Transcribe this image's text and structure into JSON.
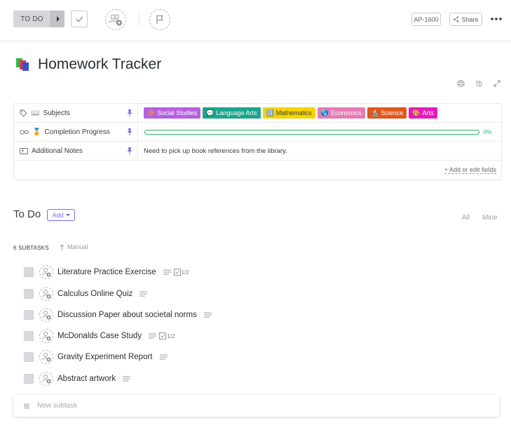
{
  "topbar": {
    "status_label": "TO DO",
    "task_id": "AP-1600",
    "share_label": "Share"
  },
  "title": {
    "text": "Homework Tracker"
  },
  "fields": {
    "subjects_label": "Subjects",
    "subjects_emoji": "📖",
    "progress_label": "Completion Progress",
    "progress_emoji": "🏅",
    "progress_percent": 0,
    "progress_text": "0%",
    "notes_label": "Additional Notes",
    "notes_value": "Need to pick up book references from the library.",
    "edit_fields_label": "+ Add or edit fields",
    "tags": [
      {
        "label": "Social Studies",
        "emoji": "🔆",
        "color": "#b660e0"
      },
      {
        "label": "Language Arts",
        "emoji": "💬",
        "color": "#1aa58c"
      },
      {
        "label": "Mathematics",
        "emoji": "🔢",
        "color": "#f5d400"
      },
      {
        "label": "Economics",
        "emoji": "🌎",
        "color": "#e57ab4"
      },
      {
        "label": "Science",
        "emoji": "🔬",
        "color": "#e2561c"
      },
      {
        "label": "Arts",
        "emoji": "🎨",
        "color": "#e51bba"
      }
    ]
  },
  "todo": {
    "title": "To Do",
    "add_label": "Add",
    "filter_all": "All",
    "filter_mine": "Mine",
    "subtasks_count": "6 SUBTASKS",
    "sort_label": "Manual",
    "new_subtask_placeholder": "New subtask",
    "subtasks": [
      {
        "name": "Literature Practice Exercise",
        "checklist": "1/2"
      },
      {
        "name": "Calculus Online Quiz",
        "checklist": ""
      },
      {
        "name": "Discussion Paper about societal norms",
        "checklist": ""
      },
      {
        "name": "McDonalds Case Study",
        "checklist": "1/2"
      },
      {
        "name": "Gravity Experiment Report",
        "checklist": ""
      },
      {
        "name": "Abstract artwork",
        "checklist": ""
      }
    ]
  },
  "colors": {
    "accent": "#7b68ee",
    "progress": "#2bb36a",
    "pin": "#7b68ee"
  }
}
